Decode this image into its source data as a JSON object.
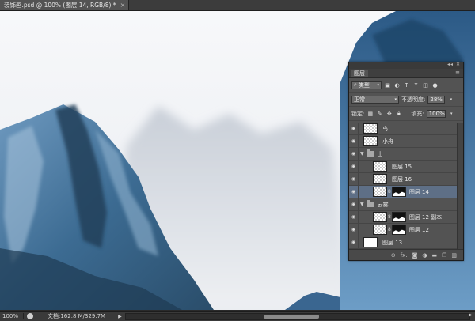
{
  "document_tab": {
    "title": "装饰画.psd @ 100% (图层 14, RGB/8) *",
    "close_glyph": "×"
  },
  "layers_panel": {
    "tab_label": "图层",
    "panel_controls": "◂◂ ✕",
    "menu_icon": "menu-icon",
    "filter": {
      "kind": "类型",
      "icons": [
        "image-filter-icon",
        "adjustment-filter-icon",
        "type-filter-icon",
        "shape-filter-icon",
        "smart-object-filter-icon",
        "filter-toggle-icon"
      ]
    },
    "blend_mode": "正常",
    "opacity_label": "不透明度:",
    "opacity_value": "28%",
    "lock_label": "锁定:",
    "lock_icons": [
      "lock-transparent-icon",
      "lock-paint-icon",
      "lock-position-icon",
      "lock-all-icon"
    ],
    "fill_label": "填充:",
    "fill_value": "100%",
    "layers": [
      {
        "name": "鸟",
        "type": "layer",
        "thumb": "transparent",
        "indent": 0,
        "selected": false
      },
      {
        "name": "小舟",
        "type": "layer",
        "thumb": "transparent",
        "indent": 0,
        "selected": false
      },
      {
        "name": "山",
        "type": "group",
        "indent": 0,
        "expanded": true
      },
      {
        "name": "图层 15",
        "type": "layer",
        "thumb": "transparent",
        "indent": 1,
        "selected": false
      },
      {
        "name": "图层 16",
        "type": "layer",
        "thumb": "transparent",
        "indent": 1,
        "selected": false
      },
      {
        "name": "图层 14",
        "type": "layer",
        "thumb": "transparent",
        "mask": true,
        "indent": 1,
        "selected": true
      },
      {
        "name": "云雾",
        "type": "group",
        "indent": 0,
        "expanded": true
      },
      {
        "name": "图层 12 副本",
        "type": "layer",
        "thumb": "transparent",
        "mask": true,
        "indent": 1,
        "selected": false
      },
      {
        "name": "图层 12",
        "type": "layer",
        "thumb": "transparent",
        "mask": true,
        "indent": 1,
        "selected": false
      },
      {
        "name": "图层 13",
        "type": "layer",
        "thumb": "white",
        "indent": 0,
        "selected": false
      }
    ],
    "footer_icons": [
      "link-layers-icon",
      "fx-icon",
      "add-mask-icon",
      "adjustment-layer-icon",
      "new-group-icon",
      "new-layer-icon",
      "delete-layer-icon"
    ],
    "footer_fx_text": "fx."
  },
  "status_bar": {
    "zoom": "100%",
    "doc_info": "文档:162.8 M/329.7M"
  },
  "colors": {
    "mountain_dark": "#2f4f6b",
    "mountain_mid": "#4f86b0",
    "selection": "#5e6f86",
    "panel_bg": "#535353"
  }
}
